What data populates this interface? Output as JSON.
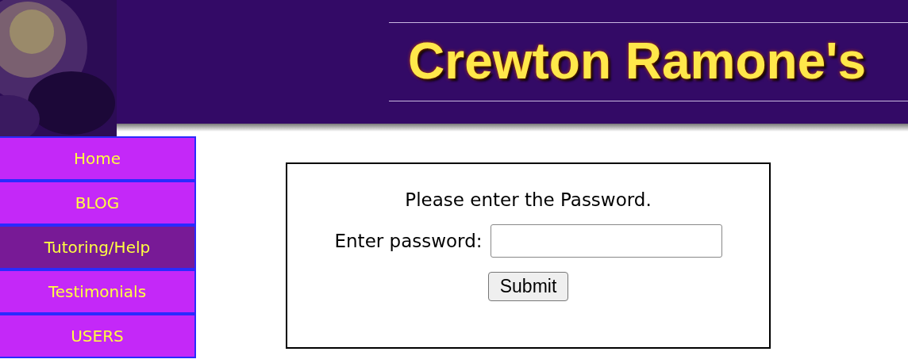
{
  "header": {
    "title": "Crewton Ramone's"
  },
  "nav": [
    {
      "label": "Home",
      "selected": false
    },
    {
      "label": "BLOG",
      "selected": false
    },
    {
      "label": "Tutoring/Help",
      "selected": true
    },
    {
      "label": "Testimonials",
      "selected": false
    },
    {
      "label": "USERS",
      "selected": false
    }
  ],
  "login": {
    "prompt": "Please enter the Password.",
    "field_label": "Enter password:",
    "button": "Submit"
  }
}
